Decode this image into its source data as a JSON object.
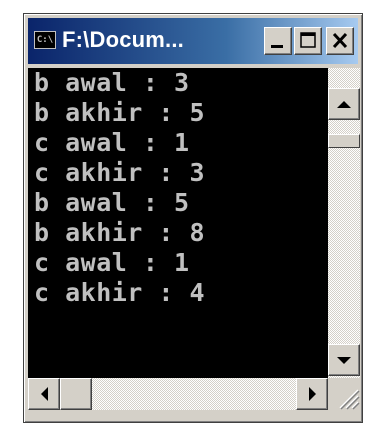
{
  "window": {
    "title": "F:\\Docum...",
    "icon_label": "C:\\",
    "buttons": [
      "minimize",
      "maximize",
      "close"
    ]
  },
  "console": {
    "lines": [
      "b awal : 3",
      "b akhir : 5",
      "c awal : 1",
      "c akhir : 3",
      "b awal : 5",
      "b akhir : 8",
      "c awal : 1",
      "c akhir : 4"
    ],
    "text_color": "#c0c0c0",
    "background": "#000000"
  },
  "icons": {
    "app": "console-app-icon",
    "minimize": "minimize-icon",
    "maximize": "maximize-icon",
    "close": "close-icon",
    "scroll_up": "arrow-up-icon",
    "scroll_down": "arrow-down-icon",
    "scroll_left": "arrow-left-icon",
    "scroll_right": "arrow-right-icon",
    "size_grip": "resize-grip-icon"
  },
  "colors": {
    "titlebar_start": "#0a246a",
    "titlebar_end": "#a6caf0",
    "chrome": "#d4d0c8"
  }
}
